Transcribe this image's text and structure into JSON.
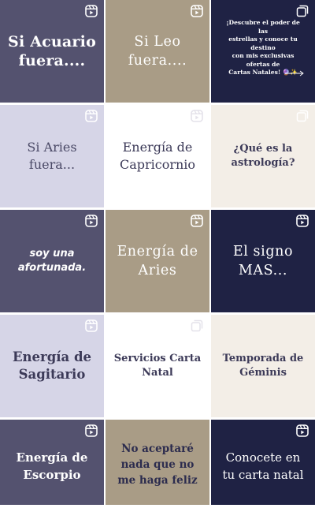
{
  "colors": {
    "slate": "#54526f",
    "taupe": "#a99c86",
    "navy": "#1f2244",
    "lavender": "#d6d5e7",
    "white": "#ffffff",
    "cream": "#f3eee7"
  },
  "posts": [
    {
      "label": "Si Acuario\nfuera....",
      "badge": "reels-icon"
    },
    {
      "label": "Si Leo\nfuera....",
      "badge": "reels-icon"
    },
    {
      "label": "¡Descubre el poder de las\nestrellas y conoce tu destino\ncon mis exclusivas ofertas de\nCartas Natales! 🔮✨",
      "badge": "carousel-icon"
    },
    {
      "label": "Si Aries\nfuera...",
      "badge": "reels-icon"
    },
    {
      "label": "Energía de\nCapricornio",
      "badge": "reels-icon"
    },
    {
      "label": "¿Qué es la\nastrología?",
      "badge": "carousel-icon"
    },
    {
      "label": "soy una\nafortunada.",
      "badge": "reels-icon"
    },
    {
      "label": "Energía de\nAries",
      "badge": "reels-icon"
    },
    {
      "label": "El signo\nMAS...",
      "badge": "reels-icon"
    },
    {
      "label": "Energía de\nSagitario",
      "badge": "reels-icon"
    },
    {
      "label": "Servicios Carta\nNatal",
      "badge": "carousel-icon"
    },
    {
      "label": "Temporada de\nGéminis",
      "badge": "none"
    },
    {
      "label": "Energía de\nEscorpio",
      "badge": "reels-icon"
    },
    {
      "label": "No aceptaré\nnada que no\nme haga feliz",
      "badge": "none"
    },
    {
      "label": "Conocete en\ntu carta natal",
      "badge": "reels-icon"
    }
  ]
}
